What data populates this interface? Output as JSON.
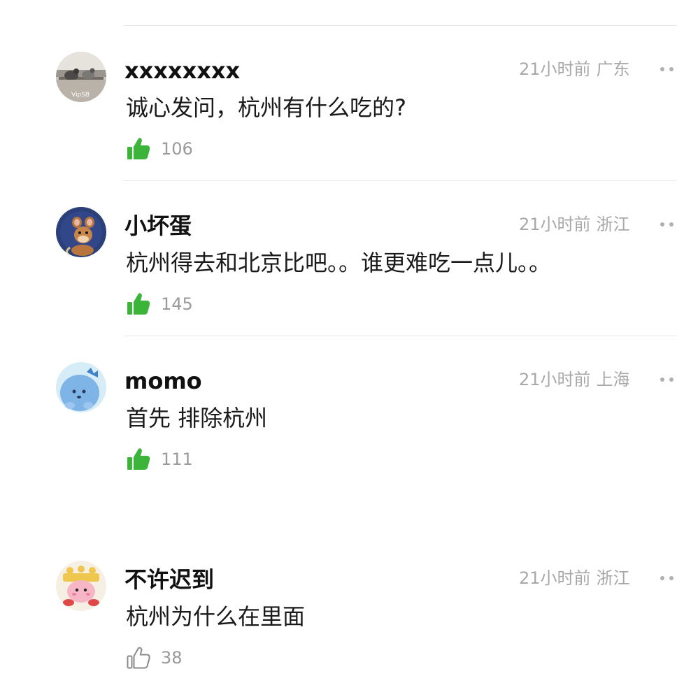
{
  "comments": [
    {
      "username": "xxxxxxxx",
      "time": "21小时前",
      "location": "广东",
      "text": "诚心发问，杭州有什么吃的?",
      "likes": "106",
      "liked": true,
      "avatar": "pigeon-photo-avatar"
    },
    {
      "username": "小坏蛋",
      "time": "21小时前",
      "location": "浙江",
      "text": "杭州得去和北京比吧。。谁更难吃一点儿。。",
      "likes": "145",
      "liked": true,
      "avatar": "cartoon-mouse-avatar"
    },
    {
      "username": "momo",
      "time": "21小时前",
      "location": "上海",
      "text": "首先 排除杭州",
      "likes": "111",
      "liked": true,
      "avatar": "blue-dinosaur-avatar"
    },
    {
      "username": "不许迟到",
      "time": "21小时前",
      "location": "浙江",
      "text": "杭州为什么在里面",
      "likes": "38",
      "liked": false,
      "avatar": "kirby-cake-avatar"
    }
  ],
  "colors": {
    "like_active": "#3cb339",
    "like_inactive": "#8a8a8a",
    "meta_text": "#a8a8a8",
    "divider": "#e8e8e8"
  }
}
